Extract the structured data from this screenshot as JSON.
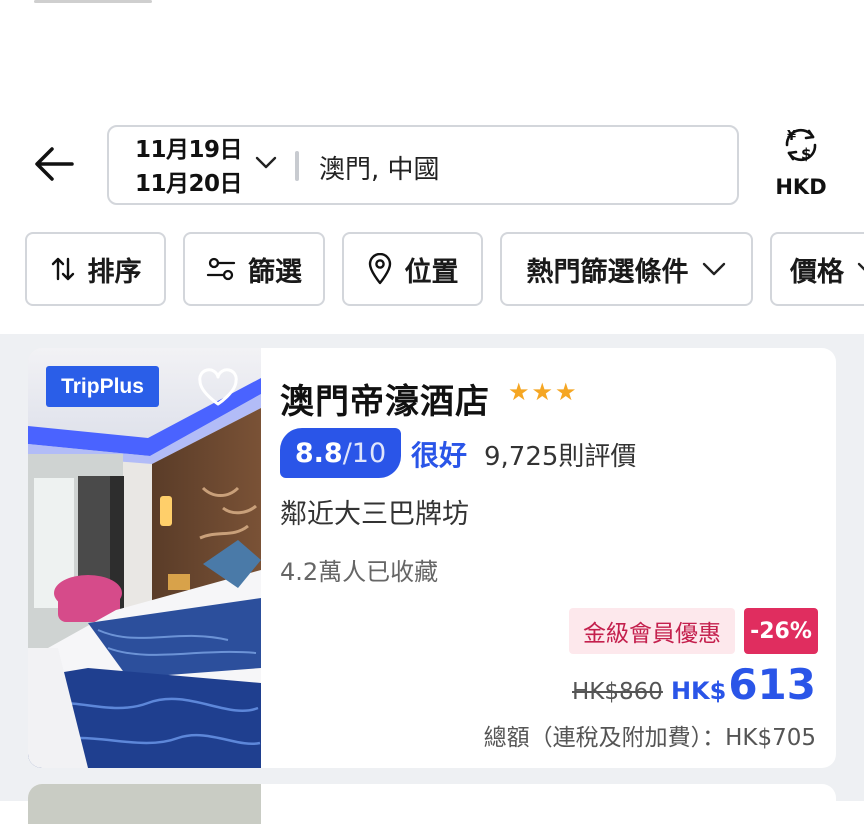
{
  "header": {
    "check_in": "11月19日",
    "check_out": "11月20日",
    "destination": "澳門, 中國",
    "currency_label": "HKD"
  },
  "filters": {
    "sort": "排序",
    "filter": "篩選",
    "location": "位置",
    "popular": "熱門篩選條件",
    "price": "價格"
  },
  "hotel": {
    "badge": "TripPlus",
    "name": "澳門帝濠酒店",
    "star_rating": 3,
    "stars_text": "★★★",
    "score": "8.8",
    "score_denominator": "/10",
    "score_word": "很好",
    "reviews": "9,725則評價",
    "nearby": "鄰近大三巴牌坊",
    "saved": "4.2萬人已收藏",
    "promo": "金級會員優惠",
    "discount": "-26%",
    "price_old": "HK$860",
    "price_currency": "HK$",
    "price_new": "613",
    "price_total": "總額（連稅及附加費）：HK$705"
  },
  "colors": {
    "brand_blue": "#2a55e8",
    "promo_bg": "#fde8ec",
    "promo_text": "#c4204d",
    "discount_bg": "#e02d5f",
    "star": "#f5a623"
  }
}
